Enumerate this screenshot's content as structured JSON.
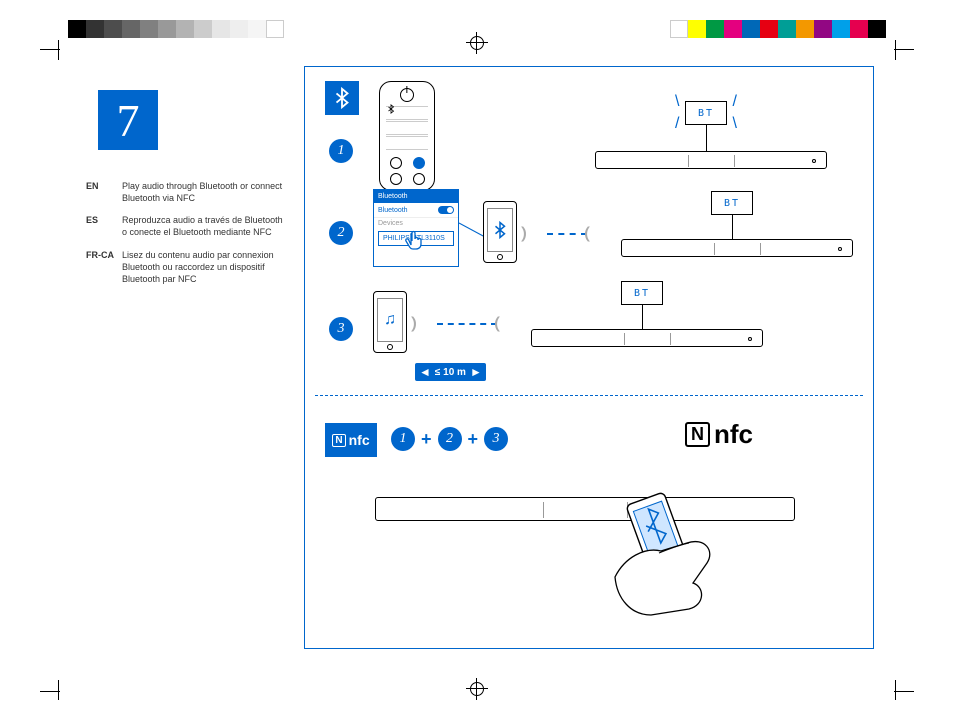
{
  "step_number": "7",
  "langs": [
    {
      "code": "EN",
      "text": "Play audio through Bluetooth or connect Bluetooth via NFC"
    },
    {
      "code": "ES",
      "text": "Reproduzca audio a través de Bluetooth o conecte el Bluetooth mediante NFC"
    },
    {
      "code": "FR-CA",
      "text": "Lisez du contenu audio par connexion Bluetooth ou raccordez un dispositif Bluetooth par NFC"
    }
  ],
  "diagram": {
    "steps": {
      "s1": "1",
      "s2": "2",
      "s3": "3"
    },
    "bt_display": "BT",
    "dialog": {
      "title": "Bluetooth",
      "row_bt": "Bluetooth",
      "row_devices": "Devices",
      "device_name": "PHILIPS HTL3110S"
    },
    "distance": "≤ 10 m",
    "nfc_chip": "nfc",
    "nfc_mark": "N",
    "nfc_logo": "nfc",
    "plus": "+"
  },
  "colorbars": {
    "left": [
      "#000",
      "#333",
      "#4d4d4d",
      "#666",
      "#808080",
      "#999",
      "#b3b3b3",
      "#ccc",
      "#e6e6e6",
      "#eee",
      "#f5f5f5",
      "#fff"
    ],
    "right": [
      "#fff",
      "#ffff00",
      "#009944",
      "#e4007f",
      "#0068b7",
      "#e60012",
      "#009e96",
      "#f39800",
      "#920783",
      "#00a0e9",
      "#e5004f",
      "#000"
    ]
  }
}
